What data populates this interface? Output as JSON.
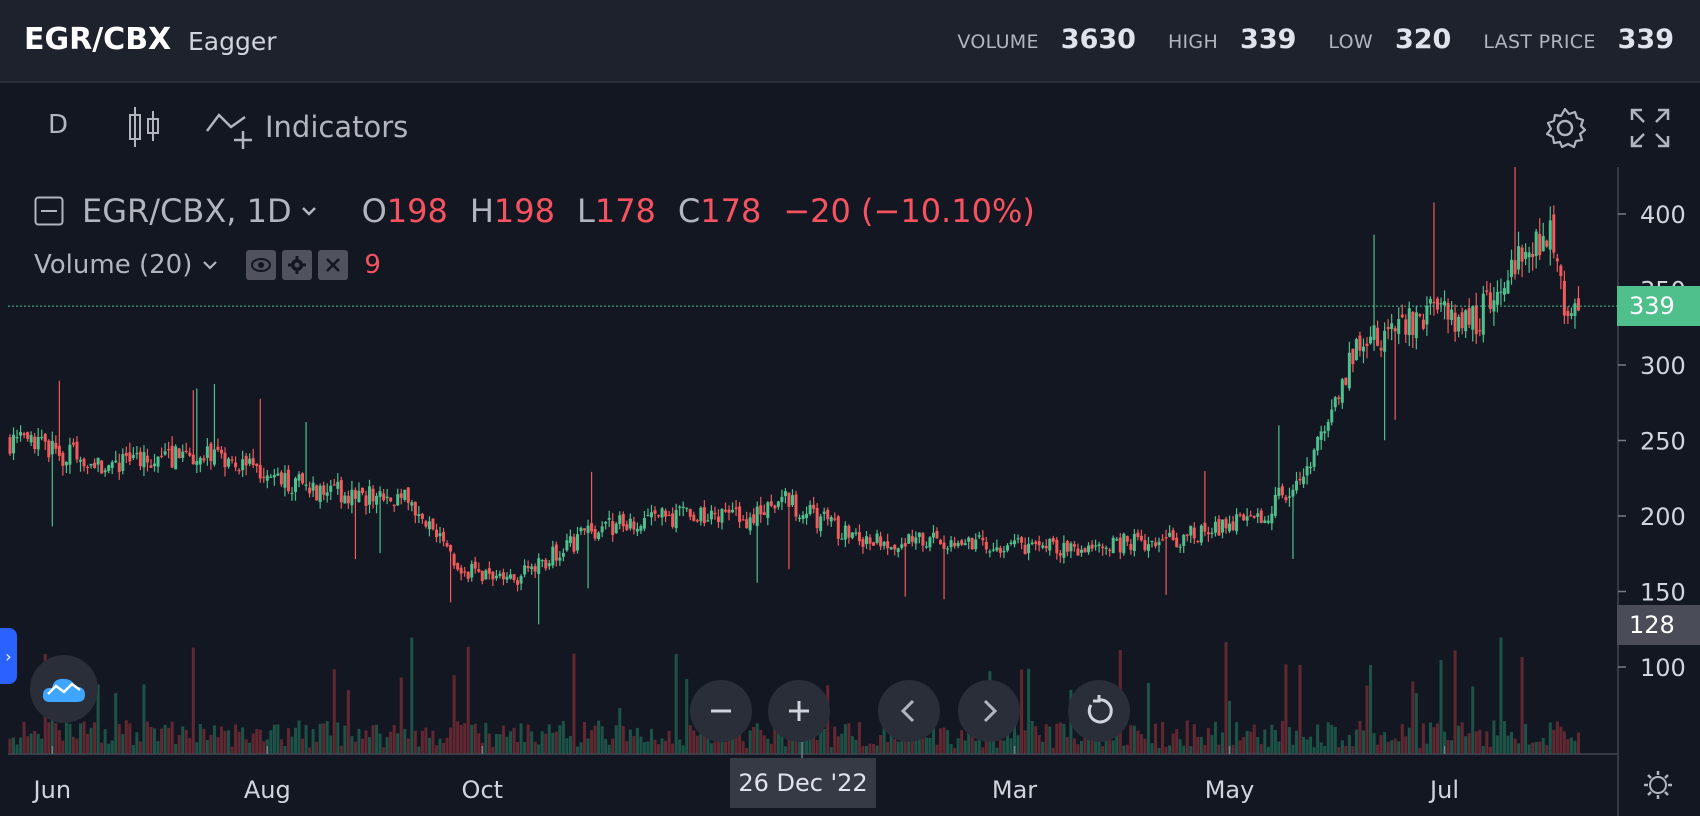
{
  "header": {
    "symbol": "EGR/CBX",
    "name": "Eagger",
    "stats": [
      {
        "label": "VOLUME",
        "value": "3630"
      },
      {
        "label": "HIGH",
        "value": "339"
      },
      {
        "label": "LOW",
        "value": "320"
      },
      {
        "label": "LAST PRICE",
        "value": "339"
      }
    ]
  },
  "toolbar": {
    "interval": "D",
    "indicators_label": "Indicators",
    "icons": [
      "candles-icon",
      "indicators-icon",
      "gear-icon",
      "fullscreen-icon"
    ]
  },
  "legend": {
    "title": "EGR/CBX, 1D",
    "o_label": "O",
    "o": "198",
    "h_label": "H",
    "h": "198",
    "l_label": "L",
    "l": "178",
    "c_label": "C",
    "c": "178",
    "change": "−20 (−10.10%)",
    "volume_label": "Volume (20)",
    "volume_value": "9"
  },
  "price_tags": {
    "last": "339",
    "volume": "128"
  },
  "crosshair_date": "26 Dec '22",
  "colors": {
    "up": "#26a69a",
    "down": "#ef5350",
    "up_candle": "#4fc08d",
    "down_candle": "#f05a5a",
    "last_tag": "#4fbf8c",
    "volume_tag": "#4a4d57",
    "background": "#131722"
  },
  "chart_data": {
    "type": "candlestick",
    "x_ticks": [
      "Jun",
      "Aug",
      "Oct",
      "Mar",
      "May",
      "Jul"
    ],
    "y_ticks": [
      100,
      150,
      200,
      250,
      300,
      350,
      400
    ],
    "ylim": [
      80,
      420
    ],
    "last_price": 339,
    "volume_level": 128,
    "legend_placement": "top-left",
    "grid": false,
    "price_path": [
      {
        "date": "2022-05-20",
        "close": 250
      },
      {
        "date": "2022-06-15",
        "close": 235
      },
      {
        "date": "2022-07-15",
        "close": 240
      },
      {
        "date": "2022-08-15",
        "close": 218
      },
      {
        "date": "2022-09-10",
        "close": 210
      },
      {
        "date": "2022-09-25",
        "close": 165
      },
      {
        "date": "2022-10-10",
        "close": 158
      },
      {
        "date": "2022-11-01",
        "close": 190
      },
      {
        "date": "2022-11-20",
        "close": 200
      },
      {
        "date": "2022-12-15",
        "close": 198
      },
      {
        "date": "2022-12-26",
        "close": 210
      },
      {
        "date": "2023-01-15",
        "close": 185
      },
      {
        "date": "2023-02-15",
        "close": 182
      },
      {
        "date": "2023-03-15",
        "close": 178
      },
      {
        "date": "2023-04-15",
        "close": 185
      },
      {
        "date": "2023-05-10",
        "close": 198
      },
      {
        "date": "2023-05-25",
        "close": 240
      },
      {
        "date": "2023-06-05",
        "close": 310
      },
      {
        "date": "2023-06-25",
        "close": 335
      },
      {
        "date": "2023-07-10",
        "close": 330
      },
      {
        "date": "2023-07-25",
        "close": 375
      },
      {
        "date": "2023-08-01",
        "close": 385
      },
      {
        "date": "2023-08-05",
        "close": 325
      },
      {
        "date": "2023-08-08",
        "close": 339
      }
    ]
  }
}
